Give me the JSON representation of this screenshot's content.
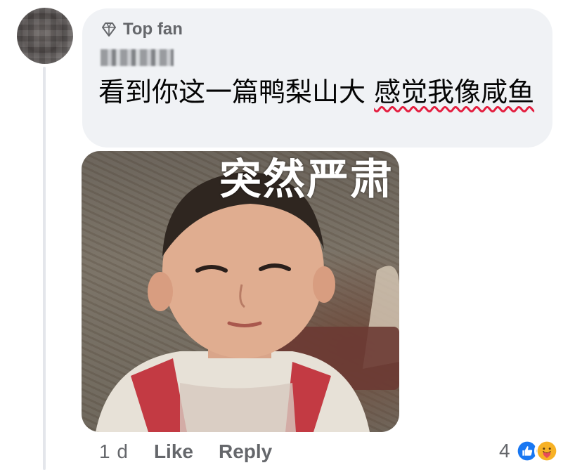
{
  "comment": {
    "badge_label": "Top fan",
    "badge_icon": "diamond-icon",
    "author_name_visible": "",
    "text_plain": "看到你这一篇鸭梨山大 ",
    "text_marked": "感觉我像咸鱼",
    "spellcheck_color": "#e41e3f",
    "attachment": {
      "type": "meme-image",
      "caption": "突然严肃"
    }
  },
  "actions": {
    "timestamp": "1 d",
    "like_label": "Like",
    "reply_label": "Reply"
  },
  "reactions": {
    "count": "4",
    "icons": [
      "like-reaction-icon",
      "care-reaction-icon"
    ],
    "like_color": "#1877f2",
    "care_color": "#f7b125"
  },
  "colors": {
    "bubble": "#f0f2f5",
    "secondary_text": "#65676b",
    "primary_text": "#050505"
  }
}
